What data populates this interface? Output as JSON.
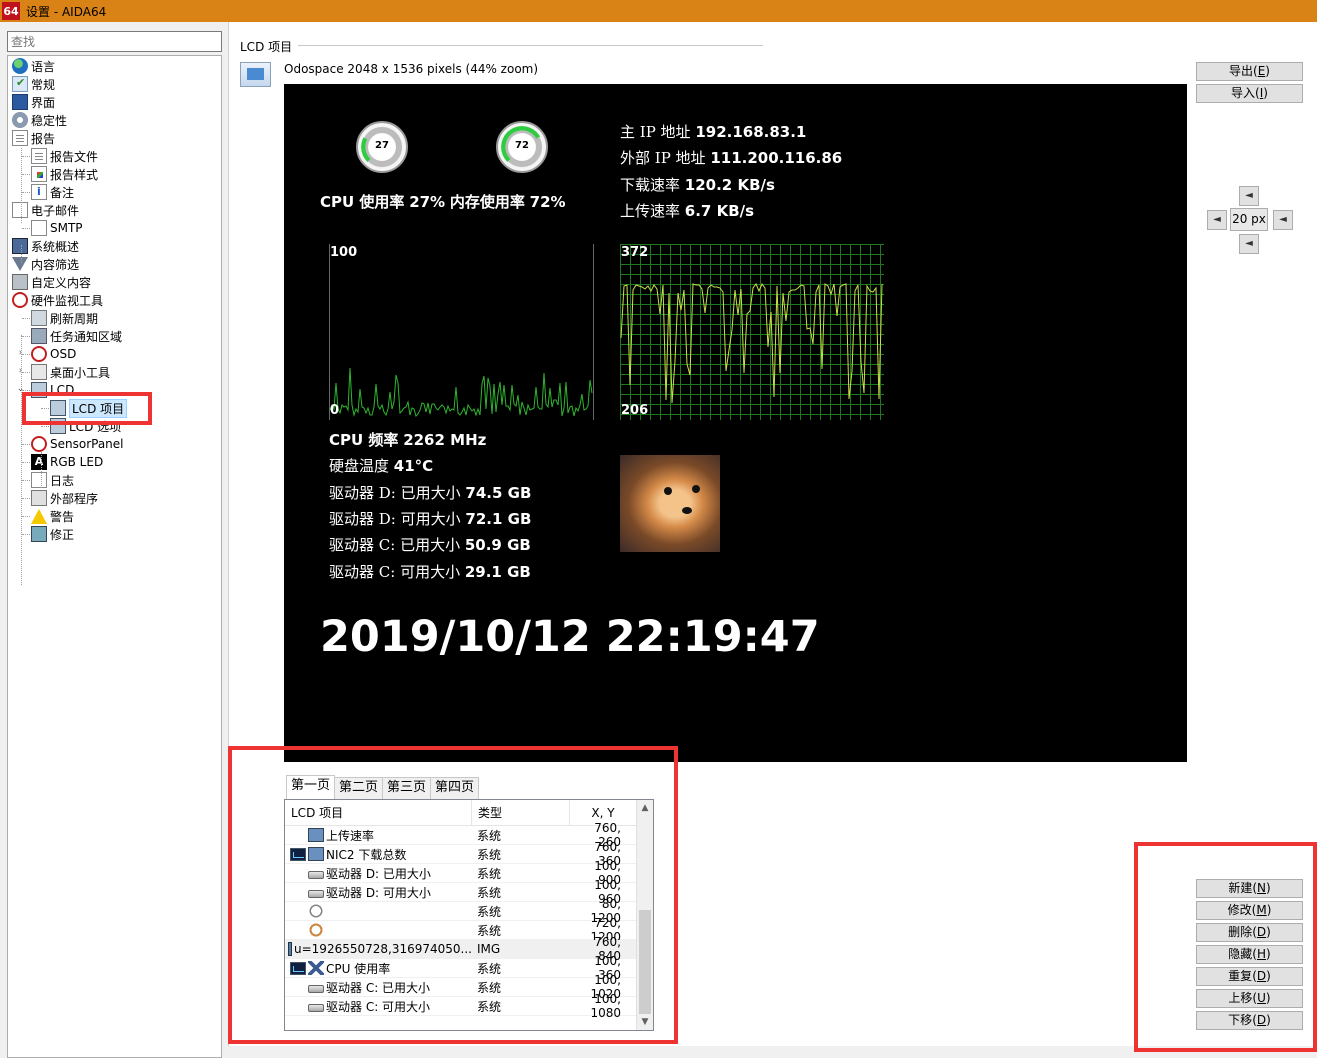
{
  "window": {
    "icon_text": "64",
    "title": "设置 - AIDA64"
  },
  "search": {
    "placeholder": "查找"
  },
  "tree": [
    {
      "label": "语言",
      "icon": "globe-icon"
    },
    {
      "label": "常规",
      "icon": "checklist-icon"
    },
    {
      "label": "界面",
      "icon": "monitor-icon"
    },
    {
      "label": "稳定性",
      "icon": "gear-icon"
    },
    {
      "label": "报告",
      "icon": "report-icon"
    },
    {
      "label": "报告文件",
      "icon": "document-icon"
    },
    {
      "label": "报告样式",
      "icon": "color-document-icon"
    },
    {
      "label": "备注",
      "icon": "info-icon"
    },
    {
      "label": "电子邮件",
      "icon": "mail-icon"
    },
    {
      "label": "SMTP",
      "icon": "server-icon"
    },
    {
      "label": "系统概述",
      "icon": "computer-icon"
    },
    {
      "label": "内容筛选",
      "icon": "filter-icon"
    },
    {
      "label": "自定义内容",
      "icon": "printer-icon"
    },
    {
      "label": "硬件监视工具",
      "icon": "gauge-icon"
    },
    {
      "label": "刷新周期",
      "icon": "clock-icon"
    },
    {
      "label": "任务通知区域",
      "icon": "tray-icon"
    },
    {
      "label": "OSD",
      "icon": "gauge-icon"
    },
    {
      "label": "桌面小工具",
      "icon": "gadget-icon"
    },
    {
      "label": "LCD",
      "icon": "lcd-icon"
    },
    {
      "label": "LCD 项目",
      "icon": "lcd-icon"
    },
    {
      "label": "LCD 选项",
      "icon": "lcd-icon"
    },
    {
      "label": "SensorPanel",
      "icon": "gauge-icon"
    },
    {
      "label": "RGB LED",
      "icon": "rgb-icon"
    },
    {
      "label": "日志",
      "icon": "log-icon"
    },
    {
      "label": "外部程序",
      "icon": "external-program-icon"
    },
    {
      "label": "警告",
      "icon": "warning-icon"
    },
    {
      "label": "修正",
      "icon": "correction-icon"
    }
  ],
  "main": {
    "group_label": "LCD 项目",
    "preview_caption": "Odospace 2048 x 1536 pixels (44% zoom)"
  },
  "lcd": {
    "cpu_gauge_value": "27",
    "mem_gauge_value": "72",
    "cpu_usage_label": "CPU 使用率",
    "cpu_usage_value": "27%",
    "mem_usage_label": "内存使用率",
    "mem_usage_value": "72%",
    "ip_main_label": "主 IP 地址",
    "ip_main_value": "192.168.83.1",
    "ip_ext_label": "外部 IP 地址",
    "ip_ext_value": "111.200.116.86",
    "down_label": "下载速率",
    "down_value": "120.2 KB/s",
    "up_label": "上传速率",
    "up_value": "6.7 KB/s",
    "graph1_max": "100",
    "graph1_min": "0",
    "graph2_max": "372",
    "graph2_min": "206",
    "cpu_freq_label": "CPU 频率",
    "cpu_freq_value": "2262 MHz",
    "disk_temp_label": "硬盘温度",
    "disk_temp_value": "41°C",
    "d_used_label": "驱动器 D: 已用大小",
    "d_used_value": "74.5 GB",
    "d_free_label": "驱动器 D: 可用大小",
    "d_free_value": "72.1 GB",
    "c_used_label": "驱动器 C: 已用大小",
    "c_used_value": "50.9 GB",
    "c_free_label": "驱动器 C: 可用大小",
    "c_free_value": "29.1 GB",
    "clock_text": "2019/10/12  22:19:47"
  },
  "side_buttons": {
    "export": {
      "label": "导出",
      "key": "E"
    },
    "import": {
      "label": "导入",
      "key": "I"
    },
    "step_value": "20 px"
  },
  "tabs": [
    "第一页",
    "第二页",
    "第三页",
    "第四页"
  ],
  "list": {
    "headers": [
      "LCD 项目",
      "类型",
      "X, Y"
    ],
    "rows": [
      {
        "graph": false,
        "icon": "system",
        "name": "上传速率",
        "type": "系统",
        "xy": "760, 260"
      },
      {
        "graph": true,
        "icon": "system",
        "name": "NIC2 下载总数",
        "type": "系统",
        "xy": "760, 360"
      },
      {
        "graph": false,
        "icon": "drive",
        "name": "驱动器 D: 已用大小",
        "type": "系统",
        "xy": "100, 900"
      },
      {
        "graph": false,
        "icon": "drive",
        "name": "驱动器 D: 可用大小",
        "type": "系统",
        "xy": "100, 960"
      },
      {
        "graph": false,
        "icon": "clock",
        "name": "",
        "type": "系统",
        "xy": "80, 1200"
      },
      {
        "graph": false,
        "icon": "alarm",
        "name": "",
        "type": "系统",
        "xy": "720, 1200"
      },
      {
        "graph": false,
        "icon": "image",
        "name": "u=1926550728,316974050...",
        "type": "IMG",
        "xy": "760, 840"
      },
      {
        "graph": true,
        "icon": "hourglass",
        "name": "CPU 使用率",
        "type": "系统",
        "xy": "100, 360"
      },
      {
        "graph": false,
        "icon": "drive",
        "name": "驱动器 C: 已用大小",
        "type": "系统",
        "xy": "100, 1020"
      },
      {
        "graph": false,
        "icon": "drive",
        "name": "驱动器 C: 可用大小",
        "type": "系统",
        "xy": "100, 1080"
      }
    ]
  },
  "action_buttons": [
    {
      "label": "新建",
      "key": "N"
    },
    {
      "label": "修改",
      "key": "M"
    },
    {
      "label": "删除",
      "key": "D"
    },
    {
      "label": "隐藏",
      "key": "H"
    },
    {
      "label": "重复",
      "key": "D"
    },
    {
      "label": "上移",
      "key": "U"
    },
    {
      "label": "下移",
      "key": "D"
    }
  ],
  "colors": {
    "titlebar": "#d98216",
    "annotation_red": "#ee3333",
    "graph_green": "#3cb83c",
    "graph_line": "#c8e04a"
  }
}
